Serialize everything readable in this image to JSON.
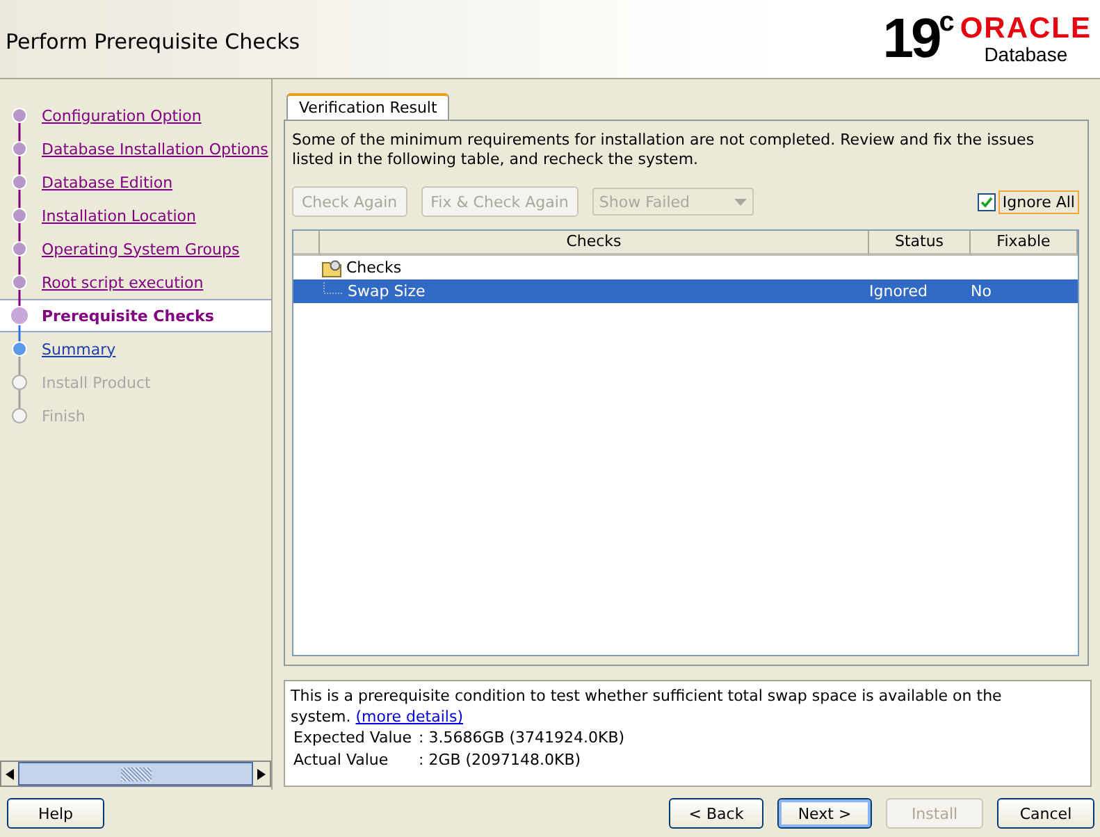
{
  "header": {
    "title": "Perform Prerequisite Checks",
    "logo_version": "19",
    "logo_version_sup": "c",
    "logo_brand": "ORACLE",
    "logo_product": "Database"
  },
  "steps": [
    {
      "label": "Configuration Option",
      "kind": "done"
    },
    {
      "label": "Database Installation Options",
      "kind": "done"
    },
    {
      "label": "Database Edition",
      "kind": "done"
    },
    {
      "label": "Installation Location",
      "kind": "done"
    },
    {
      "label": "Operating System Groups",
      "kind": "done"
    },
    {
      "label": "Root script execution",
      "kind": "done"
    },
    {
      "label": "Prerequisite Checks",
      "kind": "current"
    },
    {
      "label": "Summary",
      "kind": "next"
    },
    {
      "label": "Install Product",
      "kind": "pending"
    },
    {
      "label": "Finish",
      "kind": "pending"
    }
  ],
  "tab": {
    "label": "Verification Result",
    "selected": true
  },
  "message": "Some of the minimum requirements for installation are not completed. Review and fix the issues listed in the following table, and recheck the system.",
  "actions": [
    {
      "kind": "button",
      "label": "Check Again",
      "disabled": true
    },
    {
      "kind": "button",
      "label": "Fix & Check Again",
      "disabled": true
    },
    {
      "kind": "dropdown",
      "label": "Show Failed",
      "disabled": true
    }
  ],
  "ignore_all": {
    "label": "Ignore All",
    "checked": true,
    "focused": true
  },
  "table": {
    "columns": [
      "Checks",
      "Status",
      "Fixable"
    ],
    "rows": [
      {
        "kind": "group",
        "check": "Checks",
        "selected": false
      },
      {
        "kind": "item",
        "check": "Swap Size",
        "status": "Ignored",
        "fixable": "No",
        "selected": true
      }
    ]
  },
  "details": {
    "text": "This is a prerequisite condition to test whether sufficient total swap space is available on the system.",
    "link": "(more details)",
    "fields": [
      {
        "label": "Expected Value",
        "value": ": 3.5686GB (3741924.0KB)"
      },
      {
        "label": "Actual Value",
        "value": ": 2GB (2097148.0KB)"
      }
    ]
  },
  "buttons": [
    {
      "label": "Help",
      "disabled": false,
      "focused": false
    },
    {
      "label": "< Back",
      "disabled": false,
      "focused": false
    },
    {
      "label": "Next >",
      "disabled": false,
      "focused": true
    },
    {
      "label": "Install",
      "disabled": true,
      "focused": false
    },
    {
      "label": "Cancel",
      "disabled": false,
      "focused": false
    }
  ]
}
